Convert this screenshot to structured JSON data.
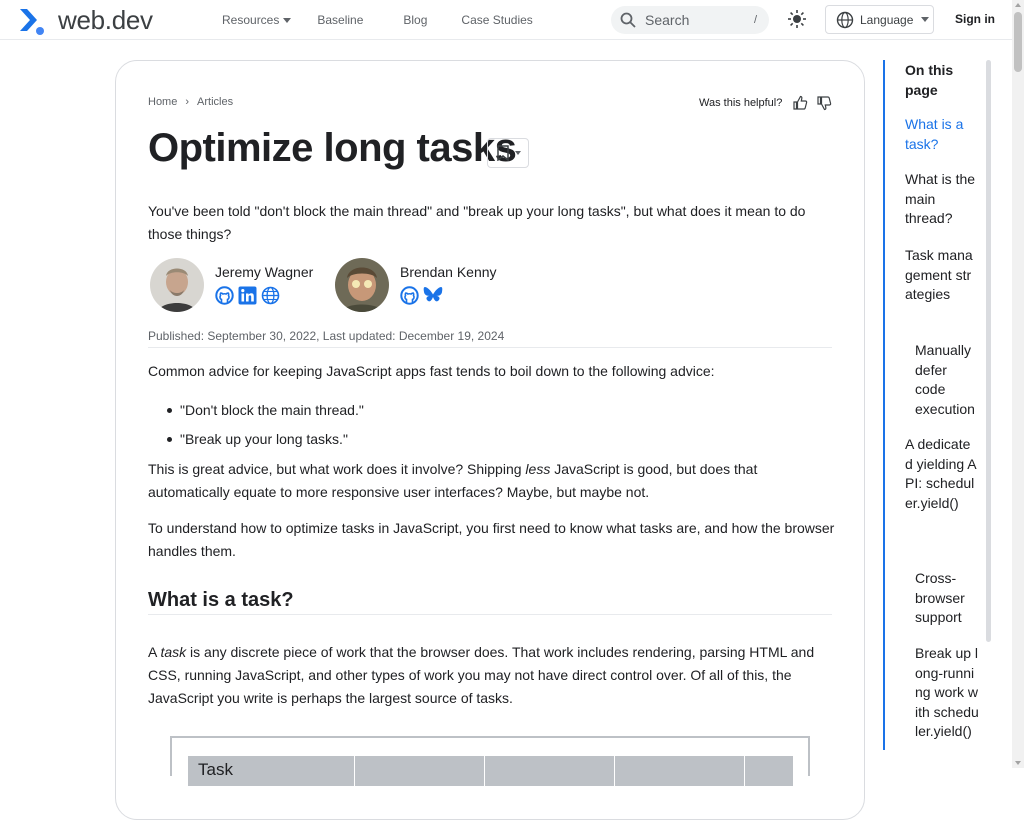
{
  "header": {
    "logo_text": "web.dev",
    "nav": [
      "Resources",
      "Baseline",
      "Blog",
      "Case Studies"
    ],
    "search_placeholder": "Search",
    "search_shortcut": "/",
    "language_label": "Language",
    "signin_label": "Sign in",
    "brand_color": "#1a73e8"
  },
  "breadcrumb": [
    "Home",
    "Articles"
  ],
  "helpful": {
    "label": "Was this helpful?"
  },
  "article": {
    "title": "Optimize long tasks",
    "intro": "You've been told \"don't block the main thread\" and \"break up your long tasks\", but what does it mean to do those things?",
    "authors": [
      {
        "name": "Jeremy Wagner",
        "links": [
          "github-icon",
          "linkedin-icon",
          "globe-icon"
        ]
      },
      {
        "name": "Brendan Kenny",
        "links": [
          "github-icon",
          "bluesky-icon"
        ]
      }
    ],
    "published": "Published: September 30, 2022, Last updated: December 19, 2024",
    "p1": "Common advice for keeping JavaScript apps fast tends to boil down to the following advice:",
    "bullets": [
      "\"Don't block the main thread.\"",
      "\"Break up your long tasks.\""
    ],
    "p2_a": "This is great advice, but what work does it involve? Shipping ",
    "p2_em": "less",
    "p2_b": " JavaScript is good, but does that automatically equate to more responsive user interfaces? Maybe, but maybe not.",
    "p3": "To understand how to optimize tasks in JavaScript, you first need to know what tasks are, and how the browser handles them.",
    "h2": "What is a task?",
    "p4_a": "A ",
    "p4_em": "task",
    "p4_b": " is any discrete piece of work that the browser does. That work includes rendering, parsing HTML and CSS, running JavaScript, and other types of work you may not have direct control over. Of all of this, the JavaScript you write is perhaps the largest source of tasks.",
    "figure_label": "Task"
  },
  "toc": {
    "heading": "On this page",
    "items": [
      {
        "label": "What is a task?",
        "active": true
      },
      {
        "label": "What is the main thread?"
      },
      {
        "label": "Task management strategies"
      },
      {
        "label": "Manually defer code execution",
        "sub": true
      },
      {
        "label": "A dedicated yielding API: scheduler.yield()"
      },
      {
        "label": "Cross-browser support",
        "sub": true
      },
      {
        "label": "Break up long-running work with scheduler.yield()",
        "sub": true
      }
    ]
  }
}
